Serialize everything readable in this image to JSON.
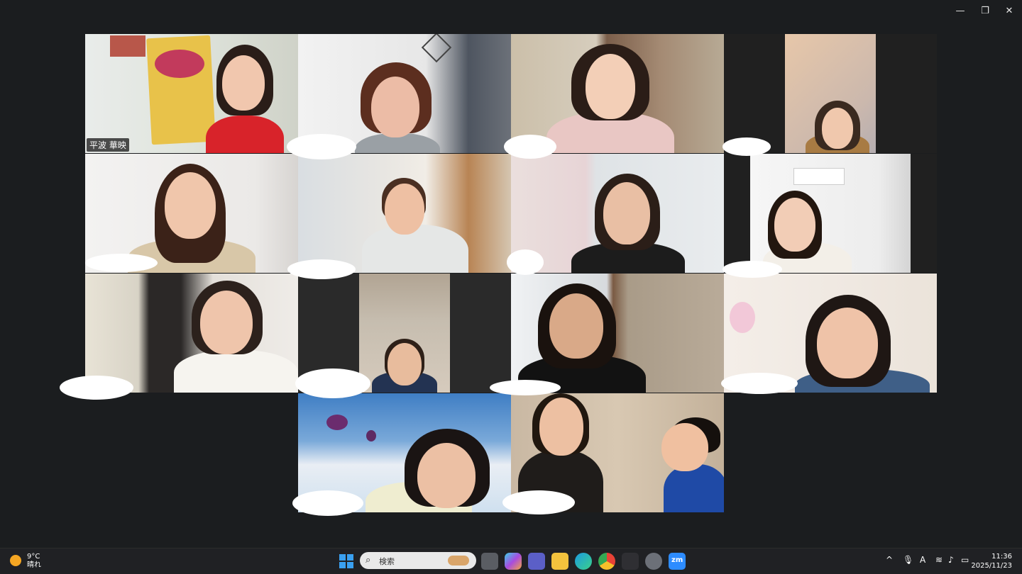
{
  "window": {
    "minimize": "—",
    "restore": "❐",
    "close": "✕"
  },
  "participants": [
    {
      "name": "平波 華映",
      "active": true
    },
    {
      "name": ""
    },
    {
      "name": ""
    },
    {
      "name": ""
    },
    {
      "name": ""
    },
    {
      "name": ""
    },
    {
      "name": ""
    },
    {
      "name": ""
    },
    {
      "name": ""
    },
    {
      "name": ""
    },
    {
      "name": ""
    },
    {
      "name": ""
    },
    {
      "name": ""
    },
    {
      "name": ""
    }
  ],
  "taskbar": {
    "weather_temp": "9°C",
    "weather_desc": "晴れ",
    "search_placeholder": "検索",
    "time": "11:36",
    "date": "2025/11/23",
    "ime": "A",
    "tray_chevron": "^"
  },
  "colors": {
    "active_border": "#2ad3a0",
    "taskbar_bg": "#202124"
  }
}
